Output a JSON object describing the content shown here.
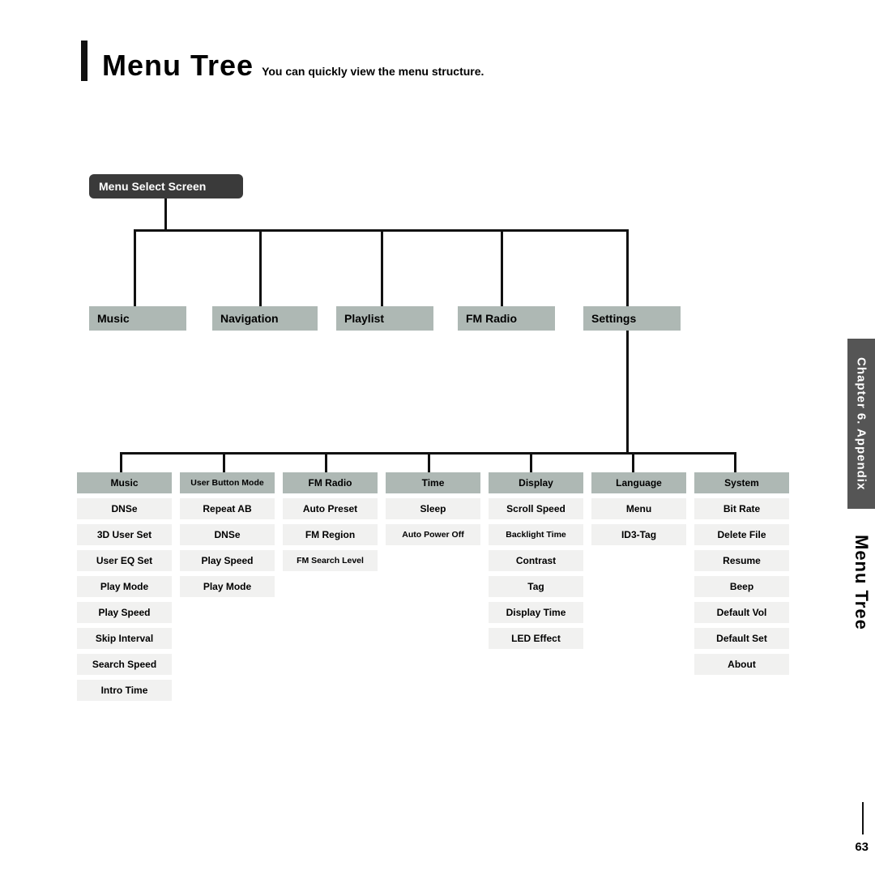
{
  "header": {
    "title": "Menu Tree",
    "subtitle": "You can quickly view the menu structure."
  },
  "root": {
    "label": "Menu Select Screen"
  },
  "categories": {
    "c1": "Music",
    "c2": "Navigation",
    "c3": "Playlist",
    "c4": "FM Radio",
    "c5": "Settings"
  },
  "settings_columns": [
    {
      "header": "Music",
      "header_small": false,
      "items": [
        "DNSe",
        "3D User Set",
        "User EQ Set",
        "Play Mode",
        "Play Speed",
        "Skip Interval",
        "Search Speed",
        "Intro Time"
      ],
      "small": []
    },
    {
      "header": "User Button Mode",
      "header_small": true,
      "items": [
        "Repeat AB",
        "DNSe",
        "Play Speed",
        "Play Mode"
      ],
      "small": []
    },
    {
      "header": "FM Radio",
      "header_small": false,
      "items": [
        "Auto Preset",
        "FM Region",
        "FM Search Level"
      ],
      "small": [
        2
      ]
    },
    {
      "header": "Time",
      "header_small": false,
      "items": [
        "Sleep",
        "Auto Power Off"
      ],
      "small": [
        1
      ]
    },
    {
      "header": "Display",
      "header_small": false,
      "items": [
        "Scroll Speed",
        "Backlight Time",
        "Contrast",
        "Tag",
        "Display Time",
        "LED Effect"
      ],
      "small": [
        1
      ]
    },
    {
      "header": "Language",
      "header_small": false,
      "items": [
        "Menu",
        "ID3-Tag"
      ],
      "small": []
    },
    {
      "header": "System",
      "header_small": false,
      "items": [
        "Bit Rate",
        "Delete File",
        "Resume",
        "Beep",
        "Default Vol",
        "Default Set",
        "About"
      ],
      "small": []
    }
  ],
  "side": {
    "chapter": "Chapter 6. Appendix",
    "section": "Menu Tree",
    "page": "63"
  }
}
